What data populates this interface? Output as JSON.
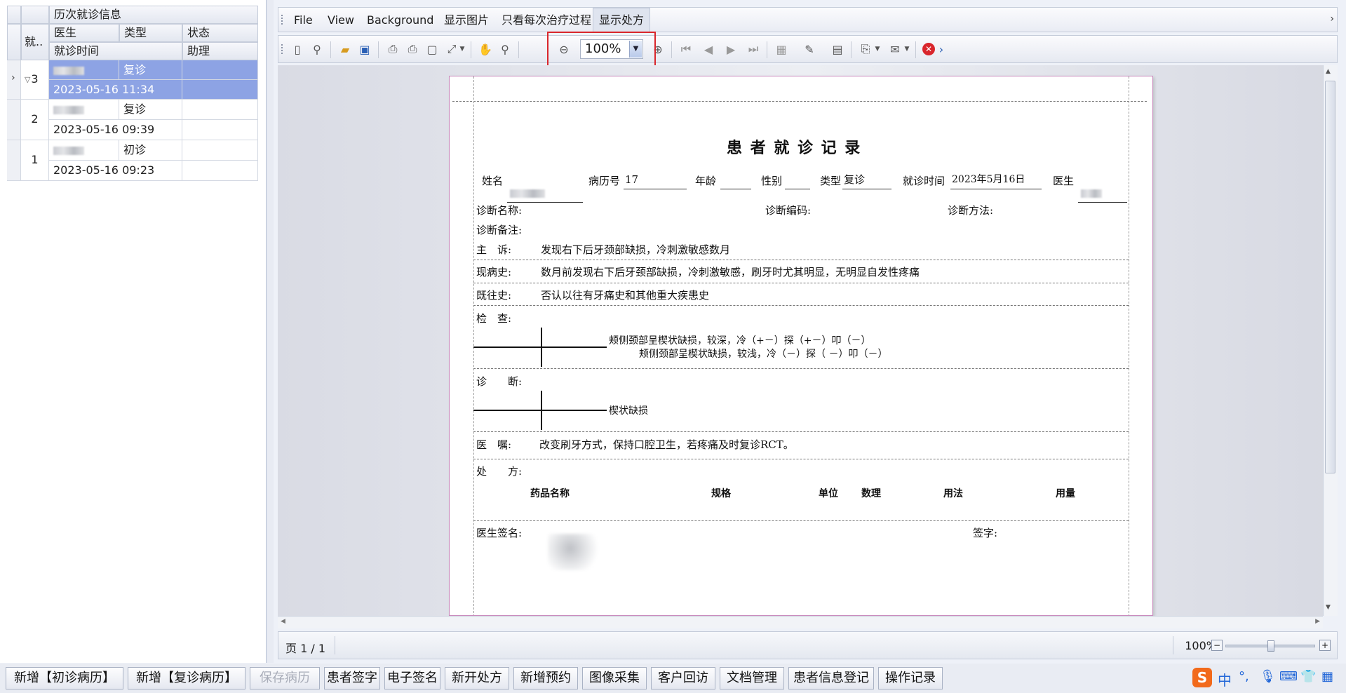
{
  "left_grid": {
    "group_header": "历次就诊信息",
    "col_no": "就..",
    "col_doctor": "医生",
    "col_type": "类型",
    "col_status": "状态",
    "col_time": "就诊时间",
    "col_assistant": "助理",
    "rows": [
      {
        "no": "3",
        "type": "复诊",
        "time": "2023-05-16 11:34",
        "selected": true
      },
      {
        "no": "2",
        "type": "复诊",
        "time": "2023-05-16 09:39",
        "selected": false
      },
      {
        "no": "1",
        "type": "初诊",
        "time": "2023-05-16 09:23",
        "selected": false
      }
    ]
  },
  "menu": {
    "file": "File",
    "view": "View",
    "background": "Background",
    "show_images": "显示图片",
    "only_process": "只看每次治疗过程",
    "show_prescription": "显示处方"
  },
  "toolbar": {
    "zoom_value": "100%",
    "icons": [
      "layout-icon",
      "find-icon",
      "open-icon",
      "save-icon",
      "print-icon",
      "quick-print-icon",
      "page-setup-icon",
      "scale-icon",
      "hand-tool-icon",
      "magnifier-icon",
      "zoom-out-icon",
      "zoom-in-icon",
      "first-page-icon",
      "prev-page-icon",
      "next-page-icon",
      "last-page-icon",
      "multipage-icon",
      "color-icon",
      "watermark-icon",
      "export-icon",
      "email-icon",
      "close-preview-icon"
    ]
  },
  "document": {
    "title": "患 者 就 诊 记 录",
    "name_label": "姓名",
    "record_no_label": "病历号",
    "record_no": "17",
    "age_label": "年龄",
    "gender_label": "性别",
    "type_label": "类型",
    "type_value": "复诊",
    "visit_time_label": "就诊时间",
    "visit_time": "2023年5月16日",
    "doctor_label": "医生",
    "diag_name_label": "诊断名称:",
    "diag_code_label": "诊断编码:",
    "diag_method_label": "诊断方法:",
    "diag_note_label": "诊断备注:",
    "complaint_label": "主　诉:",
    "complaint": "发现右下后牙颈部缺损，冷刺激敏感数月",
    "history_label": "现病史:",
    "history": "数月前发现右下后牙颈部缺损，冷刺激敏感，刷牙时尤其明显，无明显自发性疼痛",
    "past_label": "既往史:",
    "past": "否认以往有牙痛史和其他重大疾患史",
    "exam_label": "检　查:",
    "exam_line1": "颊侧颈部呈楔状缺损，较深，冷（+－）探（+－）叩（－）",
    "exam_line2": "颊侧颈部呈楔状缺损，较浅，冷（－）探（ －）叩（－）",
    "diagnosis_label": "诊　　断:",
    "diagnosis": "楔状缺损",
    "advice_label": "医　嘱:",
    "advice": "改变刷牙方式，保持口腔卫生，若疼痛及时复诊RCT。",
    "rx_label": "处　　方:",
    "rx_cols": [
      "药品名称",
      "规格",
      "单位",
      "数理",
      "用法",
      "用量"
    ],
    "doctor_sign_label": "医生签名:",
    "sign_label": "签字:"
  },
  "status": {
    "page": "页 1 / 1",
    "zoom": "100%",
    "zoom_level": 0.5
  },
  "bottom_buttons": [
    {
      "label": "新增【初诊病历】",
      "disabled": false
    },
    {
      "label": "新增【复诊病历】",
      "disabled": false
    },
    {
      "label": "保存病历",
      "disabled": true
    },
    {
      "label": "患者签字",
      "disabled": false
    },
    {
      "label": "电子签名",
      "disabled": false
    },
    {
      "label": "新开处方",
      "disabled": false
    },
    {
      "label": "新增预约",
      "disabled": false
    },
    {
      "label": "图像采集",
      "disabled": false
    },
    {
      "label": "客户回访",
      "disabled": false
    },
    {
      "label": "文档管理",
      "disabled": false
    },
    {
      "label": "患者信息登记",
      "disabled": false
    },
    {
      "label": "操作记录",
      "disabled": false
    }
  ],
  "ime": {
    "lang": "中"
  },
  "colors": {
    "selection": "#8da3e4",
    "highlight_box": "#d9262c",
    "paper_border": "#c98bbd"
  }
}
